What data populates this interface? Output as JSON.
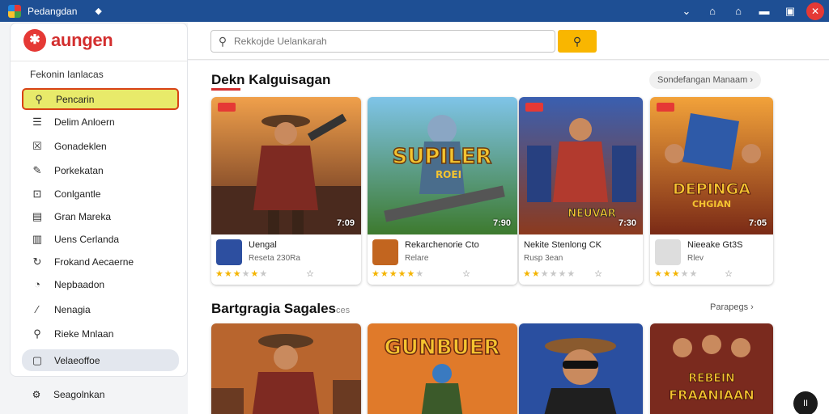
{
  "window": {
    "title": "Pedangdan",
    "pin_icon": "pin-icon"
  },
  "titlebar_icons": [
    "chevron-icon",
    "home-icon",
    "house-icon",
    "menu-icon",
    "restore-icon",
    "close-icon"
  ],
  "brand": {
    "logo_text": "aungen"
  },
  "search": {
    "placeholder": "Rekkojde Uelankarah"
  },
  "sidebar": {
    "heading": "Fekonin Ianlacas",
    "items": [
      {
        "label": "Pencarin",
        "icon": "search-icon"
      },
      {
        "label": "Delim Anloern",
        "icon": "list-icon"
      },
      {
        "label": "Gonadeklen",
        "icon": "x-box-icon"
      },
      {
        "label": "Porkekatan",
        "icon": "tag-icon"
      },
      {
        "label": "Conlgantle",
        "icon": "lock-icon"
      },
      {
        "label": "Gran Mareka",
        "icon": "calendar-icon"
      },
      {
        "label": "Uens Cerlanda",
        "icon": "book-icon"
      },
      {
        "label": "Frokand Aecaerne",
        "icon": "refresh-icon"
      },
      {
        "label": "Nepbaadon",
        "icon": "chat-icon"
      },
      {
        "label": "Nenagia",
        "icon": "pen-icon"
      },
      {
        "label": "Rieke Mnlaan",
        "icon": "magnifier-icon"
      },
      {
        "label": "Velaeoffoe",
        "icon": "clipboard-icon"
      }
    ],
    "footer_items": [
      {
        "label": "Seagolnkan",
        "icon": "settings-icon"
      }
    ]
  },
  "sections": [
    {
      "title": "Dekn Kalguisagan",
      "link": "Sondefangan Manaam",
      "cards": [
        {
          "art_text": "",
          "duration": "7:09",
          "name": "Uengal",
          "sub": "Reseta 230Ra",
          "rating": 4,
          "thumb_color": "#2d4fa0"
        },
        {
          "art_text": "SUPILER",
          "art_sub": "ROEI",
          "duration": "7:90",
          "name": "Rekarchenorie Cto",
          "sub": "Relare",
          "rating": 5,
          "thumb_color": "#c2651f"
        },
        {
          "art_text": "NEUVAR",
          "duration": "7:30",
          "name": "Nekite Stenlong CK",
          "sub": "Rusp 3ean",
          "rating": 2,
          "thumb_color": "#ffffff"
        },
        {
          "art_text": "DEPINGA",
          "art_sub": "CHGIAN",
          "duration": "7:05",
          "name": "Nieeake Gt3S",
          "sub": "Rlev",
          "rating": 3,
          "thumb_color": "#ffffff"
        }
      ]
    },
    {
      "title": "Bartgragia Sagales",
      "title_suffix": "ces",
      "link": "Parapegs",
      "cards": [
        {
          "art_text": ""
        },
        {
          "art_text": "GUNBUER"
        },
        {
          "art_text": ""
        },
        {
          "art_text": "REBEIN",
          "art_sub": "FRAANIAAN"
        }
      ]
    }
  ],
  "colors": {
    "titlebar": "#1e4f94",
    "brand_red": "#d32f2f",
    "search_button": "#f9b600",
    "star": "#f4b400",
    "active_border": "#d84315",
    "active_fill": "#e8ea6a"
  },
  "fab": {
    "label": "II"
  }
}
